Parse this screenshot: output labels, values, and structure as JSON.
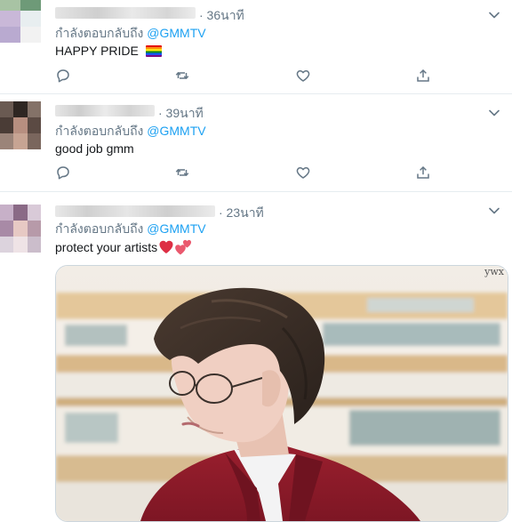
{
  "colors": {
    "accent": "#1da1f2",
    "muted": "#657786",
    "divider": "#e6ecf0",
    "heart": "#e0245e"
  },
  "icons": [
    "reply-icon",
    "retweet-icon",
    "like-icon",
    "share-icon",
    "chevron-down-icon"
  ],
  "reply_prefix": "กำลังตอบกลับถึง",
  "tweets": [
    {
      "time": "· 36นาที",
      "reply_handle": "@GMMTV",
      "text": "HAPPY PRIDE",
      "emoji": "rainbow-flag"
    },
    {
      "time": "· 39นาที",
      "reply_handle": "@GMMTV",
      "text": "good job gmm"
    },
    {
      "time": "· 23นาที",
      "reply_handle": "@GMMTV",
      "text": "protect your artists",
      "emoji": "red-heart, two-hearts"
    }
  ],
  "media": {
    "watermark": "ywx"
  }
}
